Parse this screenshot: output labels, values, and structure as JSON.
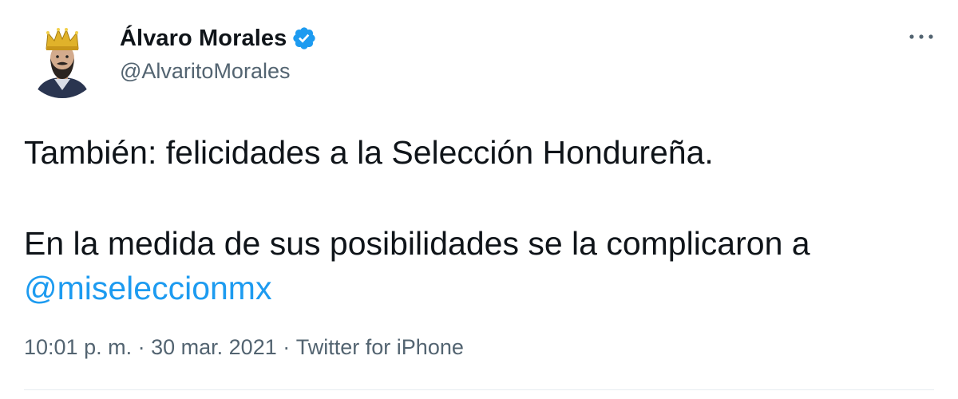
{
  "tweet": {
    "author": {
      "display_name": "Álvaro Morales",
      "handle": "@AlvaritoMorales",
      "verified": true
    },
    "text": {
      "paragraph_1": "También: felicidades a la Selección Hondureña.",
      "paragraph_2_before_mention": "En la medida de sus posibilidades se la complicaron a",
      "mention": "@miseleccionmx"
    },
    "meta": {
      "time": "10:01 p. m.",
      "separator": "·",
      "date": "30 mar. 2021",
      "source": "Twitter for iPhone"
    }
  },
  "colors": {
    "accent": "#1d9bf0",
    "text_primary": "#0f1419",
    "text_secondary": "#536471",
    "divider": "#e6ecf0"
  },
  "icons": {
    "verified": "verified-badge-icon",
    "more": "more-horizontal-icon",
    "avatar": "avatar-image"
  }
}
